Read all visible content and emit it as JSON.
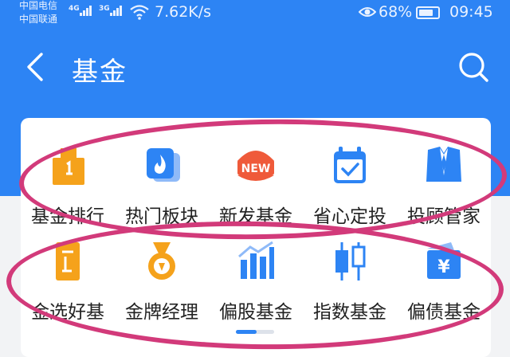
{
  "status_bar": {
    "carrier_1": "中国电信",
    "carrier_2": "中国联通",
    "network_1": "4G",
    "network_2": "3G",
    "speed": "7.62K/s",
    "battery": "68%",
    "time": "09:45"
  },
  "header": {
    "title": "基金"
  },
  "categories": [
    {
      "label": "基金排行",
      "icon": "ranking-icon"
    },
    {
      "label": "热门板块",
      "icon": "hot-sector-icon"
    },
    {
      "label": "新发基金",
      "icon": "new-badge-icon"
    },
    {
      "label": "省心定投",
      "icon": "calendar-check-icon"
    },
    {
      "label": "投顾管家",
      "icon": "advisor-suit-icon"
    },
    {
      "label": "金选好基",
      "icon": "gold-pick-icon"
    },
    {
      "label": "金牌经理",
      "icon": "gold-medal-icon"
    },
    {
      "label": "偏股基金",
      "icon": "stock-bars-icon"
    },
    {
      "label": "指数基金",
      "icon": "candlestick-icon"
    },
    {
      "label": "偏债基金",
      "icon": "bond-yen-icon"
    }
  ],
  "pager": {
    "active_page": 1,
    "pages": 2
  },
  "colors": {
    "brand_blue": "#2d84f4",
    "accent_orange": "#f5a21b",
    "accent_red": "#ef5a3a",
    "annotation_magenta": "#d23a7a"
  }
}
